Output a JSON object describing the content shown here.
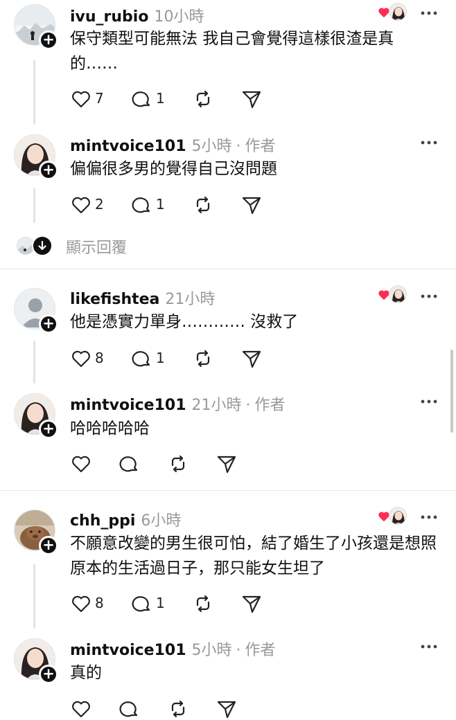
{
  "comments": [
    {
      "username": "ivu_rubio",
      "time": "10小時",
      "author_tag": "",
      "text": "保守類型可能無法 我自己會覺得這樣很渣是真的……",
      "likes": "7",
      "replies": "1",
      "liked_by_author": true
    },
    {
      "username": "mintvoice101",
      "time": "5小時",
      "author_tag": "作者",
      "text": "偏偏很多男的覺得自己沒問題",
      "likes": "2",
      "replies": "1",
      "liked_by_author": false
    },
    {
      "username": "likefishtea",
      "time": "21小時",
      "author_tag": "",
      "text": "他是憑實力單身………… 沒救了",
      "likes": "8",
      "replies": "1",
      "liked_by_author": true
    },
    {
      "username": "mintvoice101",
      "time": "21小時",
      "author_tag": "作者",
      "text": "哈哈哈哈哈",
      "likes": "",
      "replies": "",
      "liked_by_author": false
    },
    {
      "username": "chh_ppi",
      "time": "6小時",
      "author_tag": "",
      "text": "不願意改變的男生很可怕，結了婚生了小孩還是想照原本的生活過日子，那只能女生坦了",
      "likes": "8",
      "replies": "1",
      "liked_by_author": true
    },
    {
      "username": "mintvoice101",
      "time": "5小時",
      "author_tag": "作者",
      "text": "真的",
      "likes": "",
      "replies": "",
      "liked_by_author": false
    }
  ],
  "show_replies_label": "顯示回覆",
  "icons": {
    "like": "heart-outline-icon",
    "reply": "speech-bubble-icon",
    "repost": "repost-icon",
    "share": "send-icon",
    "more": "more-dots-icon",
    "follow": "plus-icon"
  },
  "colors": {
    "text": "#101010",
    "muted": "#999999",
    "heart": "#ff2d55"
  }
}
